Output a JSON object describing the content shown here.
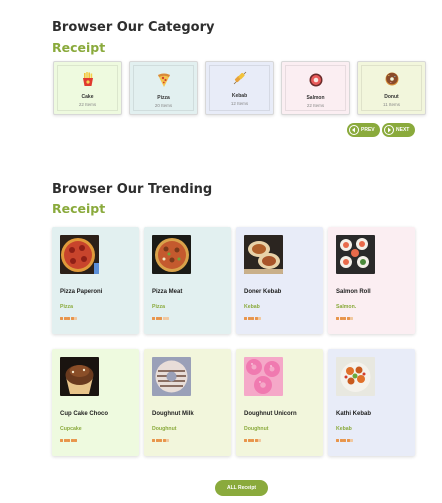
{
  "category_section": {
    "title": "Browser Our Category",
    "subtitle": "Receipt",
    "cards": [
      {
        "name": "Cake",
        "count": "22 Items",
        "icon": "fries-icon",
        "bg": "#eefadf"
      },
      {
        "name": "Pizza",
        "count": "20 Items",
        "icon": "pizza-icon",
        "bg": "#e2f0f0"
      },
      {
        "name": "Kebab",
        "count": "12 Items",
        "icon": "kebab-icon",
        "bg": "#e8ecf8"
      },
      {
        "name": "Salmon",
        "count": "22 Items",
        "icon": "salmon-icon",
        "bg": "#fbeef2"
      },
      {
        "name": "Donut",
        "count": "11 Items",
        "icon": "donut-icon",
        "bg": "#f2f6dc"
      }
    ],
    "prev_label": "PREV",
    "next_label": "NEXT"
  },
  "trending_section": {
    "title": "Browser Our Trending",
    "subtitle": "Receipt",
    "items": [
      {
        "name": "Pizza Paperoni",
        "category": "Pizza",
        "rating": 4,
        "bg": "#e2f0f0",
        "image": "pizza-pepperoni-image"
      },
      {
        "name": "Pizza Meat",
        "category": "Pizza",
        "rating": 3,
        "bg": "#e2f0f0",
        "image": "pizza-meat-image"
      },
      {
        "name": "Doner Kebab",
        "category": "Kebab",
        "rating": 4,
        "bg": "#e8ecf8",
        "image": "doner-kebab-image"
      },
      {
        "name": "Salmon Roll",
        "category": "Salmon.",
        "rating": 4,
        "bg": "#fbeef2",
        "image": "salmon-roll-image"
      },
      {
        "name": "Cup Cake Choco",
        "category": "Cupcake",
        "rating": 5,
        "bg": "#eefadf",
        "image": "cupcake-image"
      },
      {
        "name": "Doughnut Milk",
        "category": "Doughnut",
        "rating": 4,
        "bg": "#f2f6dc",
        "image": "doughnut-milk-image"
      },
      {
        "name": "Doughnut Unicorn",
        "category": "Doughnut",
        "rating": 4,
        "bg": "#f2f6dc",
        "image": "doughnut-unicorn-image"
      },
      {
        "name": "Kathi Kebab",
        "category": "Kebab",
        "rating": 4,
        "bg": "#e8ecf8",
        "image": "kathi-kebab-image"
      }
    ],
    "all_label": "ALL Receipt"
  },
  "colors": {
    "accent": "#8aaa3c",
    "rating": "#e8954b"
  }
}
